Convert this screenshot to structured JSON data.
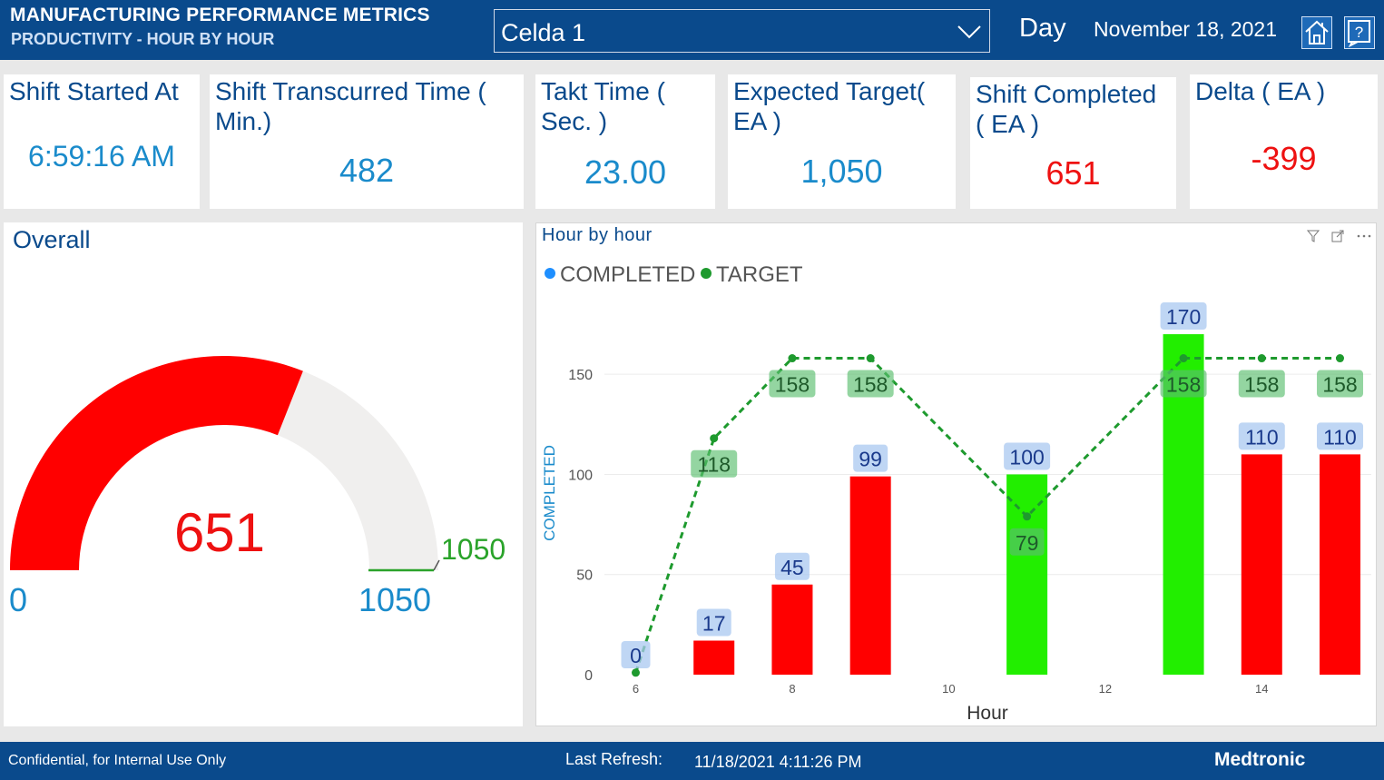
{
  "header": {
    "title": "MANUFACTURING PERFORMANCE METRICS",
    "subtitle": "PRODUCTIVITY - HOUR BY HOUR",
    "cell_selector_value": "Celda 1",
    "period": "Day",
    "date": "November 18, 2021",
    "home_icon": "home-icon",
    "help_icon": "help-icon"
  },
  "kpis": {
    "shift_started": {
      "label": "Shift Started At",
      "value": "6:59:16 AM"
    },
    "transcurred": {
      "label": "Shift Transcurred Time ( Min.)",
      "value": "482"
    },
    "takt": {
      "label": "Takt Time ( Sec. )",
      "value": "23.00"
    },
    "expected": {
      "label": "Expected Target( EA )",
      "value": "1,050"
    },
    "completed": {
      "label": "Shift Completed ( EA )",
      "value": "651"
    },
    "delta": {
      "label": "Delta ( EA )",
      "value": "-399"
    }
  },
  "overall": {
    "title": "Overall",
    "value": "651",
    "min_label": "0",
    "max_label": "1050",
    "target_label": "1050",
    "gauge_fraction": 0.62,
    "colors": {
      "fill": "#ff0000",
      "track": "#f0efee",
      "target": "#2aa32a"
    }
  },
  "hourly": {
    "title": "Hour by hour",
    "legend_completed": "COMPLETED",
    "legend_target": "TARGET",
    "toolbar_icons": [
      "filter-icon",
      "focus-mode-icon",
      "more-options-icon"
    ]
  },
  "chart_data": {
    "type": "bar",
    "xlabel": "Hour",
    "ylabel": "COMPLETED",
    "x_ticks": [
      "6",
      "8",
      "10",
      "12",
      "14"
    ],
    "y_ticks": [
      "0",
      "50",
      "100",
      "150"
    ],
    "ylim": [
      0,
      180
    ],
    "xlim": [
      5.6,
      15.4
    ],
    "x": [
      6,
      7,
      8,
      9,
      11,
      13,
      14,
      15
    ],
    "series": [
      {
        "name": "COMPLETED",
        "type": "bar",
        "values": [
          0,
          17,
          45,
          99,
          100,
          170,
          110,
          110
        ],
        "colors": [
          "#ff0000",
          "#ff0000",
          "#ff0000",
          "#ff0000",
          "#22ee00",
          "#22ee00",
          "#ff0000",
          "#ff0000"
        ]
      },
      {
        "name": "TARGET",
        "type": "line",
        "values": [
          1,
          118,
          158,
          158,
          79,
          158,
          158,
          158
        ],
        "color": "#1e9a2e"
      }
    ],
    "completed_labels": [
      "0",
      "17",
      "45",
      "99",
      "100",
      "170",
      "110",
      "110"
    ],
    "target_labels": [
      null,
      "118",
      "158",
      "158",
      "79",
      "158",
      "158",
      "158"
    ],
    "legend_position": "top-left"
  },
  "footer": {
    "confidential": "Confidential, for Internal Use Only",
    "refresh_label": "Last Refresh:",
    "refresh_value": "11/18/2021 4:11:26 PM",
    "brand": "Medtronic"
  }
}
